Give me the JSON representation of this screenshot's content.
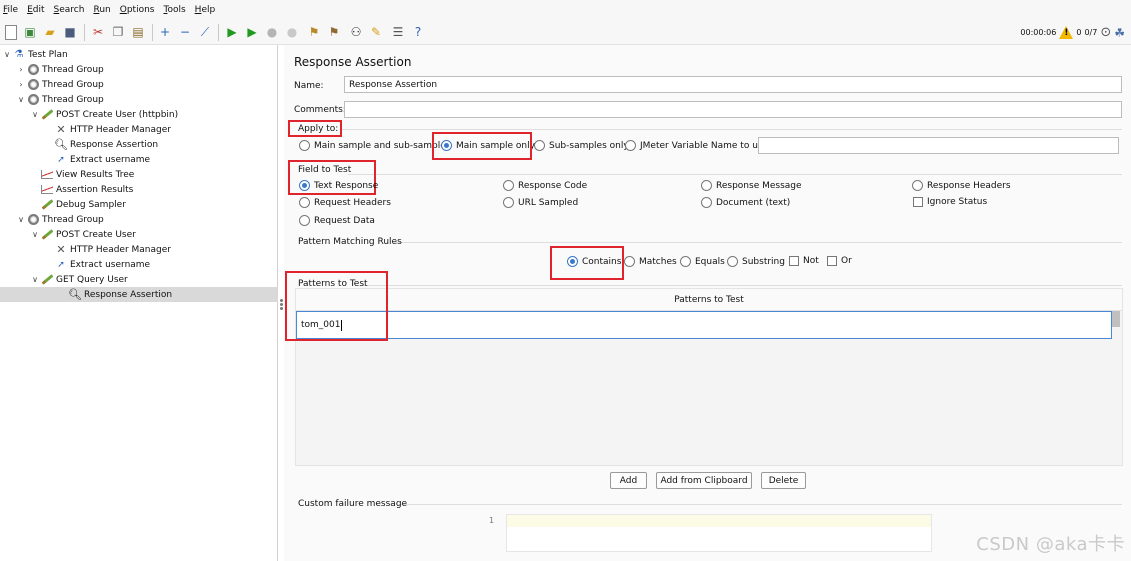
{
  "menu": [
    "File",
    "Edit",
    "Search",
    "Run",
    "Options",
    "Tools",
    "Help"
  ],
  "status": {
    "time": "00:00:06",
    "warnings": "0",
    "threads": "0/7"
  },
  "tree": [
    {
      "label": "Test Plan",
      "depth": 0,
      "icon": "flask-icon",
      "chevron": "∨"
    },
    {
      "label": "Thread Group",
      "depth": 1,
      "icon": "gear-icon",
      "chevron": "›"
    },
    {
      "label": "Thread Group",
      "depth": 1,
      "icon": "gear-icon",
      "chevron": "›"
    },
    {
      "label": "Thread Group",
      "depth": 1,
      "icon": "gear-icon",
      "chevron": "∨"
    },
    {
      "label": "POST Create User (httpbin)",
      "depth": 2,
      "icon": "pen-icon",
      "chevron": "∨"
    },
    {
      "label": "HTTP Header Manager",
      "depth": 3,
      "icon": "tools-icon",
      "chevron": ""
    },
    {
      "label": "Response Assertion",
      "depth": 3,
      "icon": "magnifier-icon",
      "chevron": ""
    },
    {
      "label": "Extract username",
      "depth": 3,
      "icon": "arrow-icon",
      "chevron": ""
    },
    {
      "label": "View Results Tree",
      "depth": 2,
      "icon": "chart-icon",
      "chevron": ""
    },
    {
      "label": "Assertion Results",
      "depth": 2,
      "icon": "chart-icon",
      "chevron": ""
    },
    {
      "label": "Debug Sampler",
      "depth": 2,
      "icon": "pen-icon",
      "chevron": ""
    },
    {
      "label": "Thread Group",
      "depth": 1,
      "icon": "gear-icon",
      "chevron": "∨"
    },
    {
      "label": "POST Create User",
      "depth": 2,
      "icon": "pen-icon",
      "chevron": "∨"
    },
    {
      "label": "HTTP Header Manager",
      "depth": 3,
      "icon": "tools-icon",
      "chevron": ""
    },
    {
      "label": "Extract username",
      "depth": 3,
      "icon": "arrow-icon",
      "chevron": ""
    },
    {
      "label": "GET Query User",
      "depth": 2,
      "icon": "pen-icon",
      "chevron": "∨"
    },
    {
      "label": "Response Assertion",
      "depth": 3,
      "icon": "magnifier-icon",
      "chevron": "",
      "selected": true
    }
  ],
  "panel": {
    "title": "Response Assertion",
    "name_label": "Name:",
    "name_value": "Response Assertion",
    "comments_label": "Comments:",
    "comments_value": "",
    "apply_to": {
      "label": "Apply to:",
      "options": [
        "Main sample and sub-samples",
        "Main sample only",
        "Sub-samples only",
        "JMeter Variable Name to use"
      ],
      "selected": "Main sample only",
      "variable_value": ""
    },
    "field_to_test": {
      "label": "Field to Test",
      "options": [
        "Text Response",
        "Response Code",
        "Response Message",
        "Response Headers",
        "Request Headers",
        "URL Sampled",
        "Document (text)",
        "Request Data"
      ],
      "checkbox": "Ignore Status",
      "selected": "Text Response"
    },
    "pattern_rules": {
      "label": "Pattern Matching Rules",
      "options": [
        "Contains",
        "Matches",
        "Equals",
        "Substring"
      ],
      "selected": "Contains",
      "checkboxes": [
        "Not",
        "Or"
      ]
    },
    "patterns": {
      "label": "Patterns to Test",
      "column_header": "Patterns to Test",
      "rows": [
        "tom_001"
      ]
    },
    "buttons": {
      "add": "Add",
      "add_clipboard": "Add from Clipboard",
      "delete": "Delete"
    },
    "failure": {
      "label": "Custom failure message",
      "line_number": "1",
      "value": ""
    }
  },
  "watermark": "CSDN @aka卡卡",
  "colors": {
    "highlight": "#e0242b",
    "radio_selected": "#3a78c9",
    "selected_row": "#d9d9d9"
  }
}
